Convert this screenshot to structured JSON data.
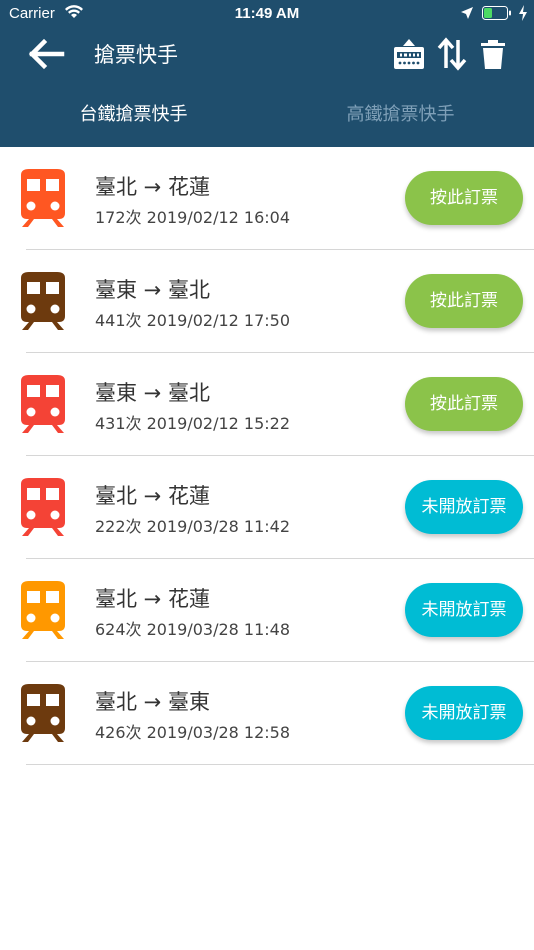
{
  "status_bar": {
    "carrier": "Carrier",
    "time": "11:49 AM"
  },
  "nav": {
    "title": "搶票快手",
    "icons": [
      "back-arrow-icon",
      "hotel-icon",
      "swap-icon",
      "trash-icon"
    ]
  },
  "tabs": [
    {
      "label": "台鐵搶票快手",
      "active": true
    },
    {
      "label": "高鐵搶票快手",
      "active": false
    }
  ],
  "colors": {
    "header": "#1f4e6d",
    "book_button": "#8bc34a",
    "not_open_button": "#00bcd4"
  },
  "tickets": [
    {
      "route": "臺北 → 花蓮",
      "detail": "172次 2019/02/12 16:04",
      "button": "按此訂票",
      "train_color": "#ff5722",
      "button_color": "#8bc34a"
    },
    {
      "route": "臺東 → 臺北",
      "detail": "441次 2019/02/12 17:50",
      "button": "按此訂票",
      "train_color": "#6d3a0e",
      "button_color": "#8bc34a"
    },
    {
      "route": "臺東 → 臺北",
      "detail": "431次 2019/02/12 15:22",
      "button": "按此訂票",
      "train_color": "#f44336",
      "button_color": "#8bc34a"
    },
    {
      "route": "臺北 → 花蓮",
      "detail": "222次 2019/03/28 11:42",
      "button": "未開放訂票",
      "train_color": "#f44336",
      "button_color": "#00bcd4"
    },
    {
      "route": "臺北 → 花蓮",
      "detail": "624次 2019/03/28 11:48",
      "button": "未開放訂票",
      "train_color": "#ff9800",
      "button_color": "#00bcd4"
    },
    {
      "route": "臺北 → 臺東",
      "detail": "426次 2019/03/28 12:58",
      "button": "未開放訂票",
      "train_color": "#6d3a0e",
      "button_color": "#00bcd4"
    }
  ]
}
